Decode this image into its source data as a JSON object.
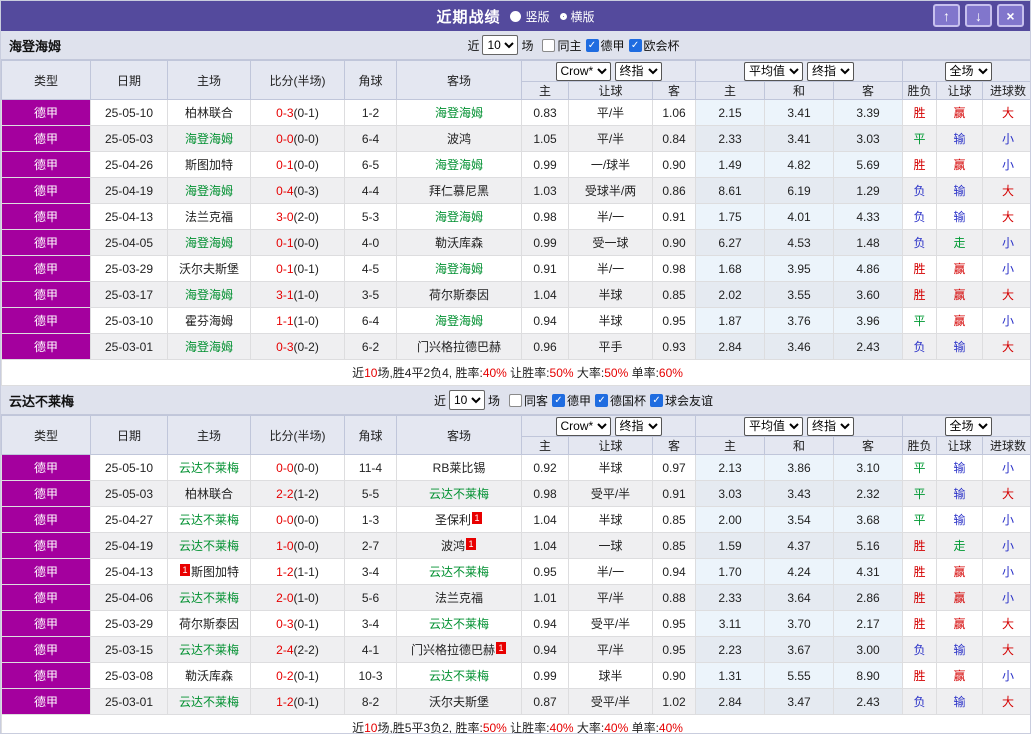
{
  "titlebar": {
    "title": "近期战绩",
    "radios": [
      {
        "label": "竖版",
        "selected": true
      },
      {
        "label": "横版",
        "selected": false
      }
    ],
    "buttons": {
      "up": "↑",
      "down": "↓",
      "close": "×"
    }
  },
  "colors": {
    "titlebar_bg": "#544a9d",
    "type_cell_bg": "#a4009e",
    "self_team": "#009030",
    "score_red": "#e60000",
    "win_red": "#d40000",
    "draw_green": "#009933",
    "loss_blue": "#2b32c8",
    "avg_col_bg": "#ecf4fb"
  },
  "outcome_colors": {
    "胜": "#d40000",
    "赢": "#d40000",
    "大": "#d40000",
    "平": "#009933",
    "走": "#009933",
    "负": "#2b32c8",
    "输": "#2b32c8",
    "小": "#2b32c8"
  },
  "table_headers": {
    "left": [
      "类型",
      "日期",
      "主场",
      "比分(半场)",
      "角球",
      "客场"
    ],
    "odds_selects": [
      "Crow*",
      "终指"
    ],
    "avg_selects": [
      "平均值",
      "终指"
    ],
    "full_select": "全场",
    "odds_cols": [
      "主",
      "让球",
      "客"
    ],
    "avg_cols": [
      "主",
      "和",
      "客"
    ],
    "result_cols": [
      "胜负",
      "让球",
      "进球数"
    ]
  },
  "filter_labels": {
    "prefix": "近",
    "suffix": "场"
  },
  "sections": [
    {
      "team": "海登海姆",
      "filter": {
        "count": "10",
        "checkboxes": [
          {
            "label": "同主",
            "checked": false
          },
          {
            "label": "德甲",
            "checked": true
          },
          {
            "label": "欧会杯",
            "checked": true
          }
        ]
      },
      "rows": [
        {
          "league": "德甲",
          "date": "25-05-10",
          "home": {
            "name": "柏林联合",
            "self": false
          },
          "score": "0-3",
          "half": "(0-1)",
          "corner": "1-2",
          "away": {
            "name": "海登海姆",
            "self": true
          },
          "odds": [
            "0.83",
            "平/半",
            "1.06"
          ],
          "avg": [
            "2.15",
            "3.41",
            "3.39"
          ],
          "results": [
            "胜",
            "赢",
            "大"
          ]
        },
        {
          "league": "德甲",
          "date": "25-05-03",
          "home": {
            "name": "海登海姆",
            "self": true
          },
          "score": "0-0",
          "half": "(0-0)",
          "corner": "6-4",
          "away": {
            "name": "波鸿",
            "self": false
          },
          "odds": [
            "1.05",
            "平/半",
            "0.84"
          ],
          "avg": [
            "2.33",
            "3.41",
            "3.03"
          ],
          "results": [
            "平",
            "输",
            "小"
          ]
        },
        {
          "league": "德甲",
          "date": "25-04-26",
          "home": {
            "name": "斯图加特",
            "self": false
          },
          "score": "0-1",
          "half": "(0-0)",
          "corner": "6-5",
          "away": {
            "name": "海登海姆",
            "self": true
          },
          "odds": [
            "0.99",
            "一/球半",
            "0.90"
          ],
          "avg": [
            "1.49",
            "4.82",
            "5.69"
          ],
          "results": [
            "胜",
            "赢",
            "小"
          ]
        },
        {
          "league": "德甲",
          "date": "25-04-19",
          "home": {
            "name": "海登海姆",
            "self": true
          },
          "score": "0-4",
          "half": "(0-3)",
          "corner": "4-4",
          "away": {
            "name": "拜仁慕尼黑",
            "self": false
          },
          "odds": [
            "1.03",
            "受球半/两",
            "0.86"
          ],
          "avg": [
            "8.61",
            "6.19",
            "1.29"
          ],
          "results": [
            "负",
            "输",
            "大"
          ]
        },
        {
          "league": "德甲",
          "date": "25-04-13",
          "home": {
            "name": "法兰克福",
            "self": false
          },
          "score": "3-0",
          "half": "(2-0)",
          "corner": "5-3",
          "away": {
            "name": "海登海姆",
            "self": true
          },
          "odds": [
            "0.98",
            "半/一",
            "0.91"
          ],
          "avg": [
            "1.75",
            "4.01",
            "4.33"
          ],
          "results": [
            "负",
            "输",
            "大"
          ]
        },
        {
          "league": "德甲",
          "date": "25-04-05",
          "home": {
            "name": "海登海姆",
            "self": true
          },
          "score": "0-1",
          "half": "(0-0)",
          "corner": "4-0",
          "away": {
            "name": "勒沃库森",
            "self": false
          },
          "odds": [
            "0.99",
            "受一球",
            "0.90"
          ],
          "avg": [
            "6.27",
            "4.53",
            "1.48"
          ],
          "results": [
            "负",
            "走",
            "小"
          ]
        },
        {
          "league": "德甲",
          "date": "25-03-29",
          "home": {
            "name": "沃尔夫斯堡",
            "self": false
          },
          "score": "0-1",
          "half": "(0-1)",
          "corner": "4-5",
          "away": {
            "name": "海登海姆",
            "self": true
          },
          "odds": [
            "0.91",
            "半/一",
            "0.98"
          ],
          "avg": [
            "1.68",
            "3.95",
            "4.86"
          ],
          "results": [
            "胜",
            "赢",
            "小"
          ]
        },
        {
          "league": "德甲",
          "date": "25-03-17",
          "home": {
            "name": "海登海姆",
            "self": true
          },
          "score": "3-1",
          "half": "(1-0)",
          "corner": "3-5",
          "away": {
            "name": "荷尔斯泰因",
            "self": false
          },
          "odds": [
            "1.04",
            "半球",
            "0.85"
          ],
          "avg": [
            "2.02",
            "3.55",
            "3.60"
          ],
          "results": [
            "胜",
            "赢",
            "大"
          ]
        },
        {
          "league": "德甲",
          "date": "25-03-10",
          "home": {
            "name": "霍芬海姆",
            "self": false
          },
          "score": "1-1",
          "half": "(1-0)",
          "corner": "6-4",
          "away": {
            "name": "海登海姆",
            "self": true
          },
          "odds": [
            "0.94",
            "半球",
            "0.95"
          ],
          "avg": [
            "1.87",
            "3.76",
            "3.96"
          ],
          "results": [
            "平",
            "赢",
            "小"
          ]
        },
        {
          "league": "德甲",
          "date": "25-03-01",
          "home": {
            "name": "海登海姆",
            "self": true
          },
          "score": "0-3",
          "half": "(0-2)",
          "corner": "6-2",
          "away": {
            "name": "门兴格拉德巴赫",
            "self": false
          },
          "odds": [
            "0.96",
            "平手",
            "0.93"
          ],
          "avg": [
            "2.84",
            "3.46",
            "2.43"
          ],
          "results": [
            "负",
            "输",
            "大"
          ]
        }
      ],
      "summary": [
        {
          "t": "近"
        },
        {
          "t": "10",
          "red": true
        },
        {
          "t": "场,胜4平2负4, 胜率:"
        },
        {
          "t": "40%",
          "red": true
        },
        {
          "t": " 让胜率:"
        },
        {
          "t": "50%",
          "red": true
        },
        {
          "t": " 大率:"
        },
        {
          "t": "50%",
          "red": true
        },
        {
          "t": " 单率:"
        },
        {
          "t": "60%",
          "red": true
        }
      ]
    },
    {
      "team": "云达不莱梅",
      "filter": {
        "count": "10",
        "checkboxes": [
          {
            "label": "同客",
            "checked": false
          },
          {
            "label": "德甲",
            "checked": true
          },
          {
            "label": "德国杯",
            "checked": true
          },
          {
            "label": "球会友谊",
            "checked": true
          }
        ]
      },
      "rows": [
        {
          "league": "德甲",
          "date": "25-05-10",
          "home": {
            "name": "云达不莱梅",
            "self": true
          },
          "score": "0-0",
          "half": "(0-0)",
          "corner": "11-4",
          "away": {
            "name": "RB莱比锡",
            "self": false
          },
          "odds": [
            "0.92",
            "半球",
            "0.97"
          ],
          "avg": [
            "2.13",
            "3.86",
            "3.10"
          ],
          "results": [
            "平",
            "输",
            "小"
          ]
        },
        {
          "league": "德甲",
          "date": "25-05-03",
          "home": {
            "name": "柏林联合",
            "self": false
          },
          "score": "2-2",
          "half": "(1-2)",
          "corner": "5-5",
          "away": {
            "name": "云达不莱梅",
            "self": true
          },
          "odds": [
            "0.98",
            "受平/半",
            "0.91"
          ],
          "avg": [
            "3.03",
            "3.43",
            "2.32"
          ],
          "results": [
            "平",
            "输",
            "大"
          ]
        },
        {
          "league": "德甲",
          "date": "25-04-27",
          "home": {
            "name": "云达不莱梅",
            "self": true
          },
          "score": "0-0",
          "half": "(0-0)",
          "corner": "1-3",
          "away": {
            "name": "圣保利",
            "self": false,
            "badge": "1",
            "badge_pos": "after"
          },
          "odds": [
            "1.04",
            "半球",
            "0.85"
          ],
          "avg": [
            "2.00",
            "3.54",
            "3.68"
          ],
          "results": [
            "平",
            "输",
            "小"
          ]
        },
        {
          "league": "德甲",
          "date": "25-04-19",
          "home": {
            "name": "云达不莱梅",
            "self": true
          },
          "score": "1-0",
          "half": "(0-0)",
          "corner": "2-7",
          "away": {
            "name": "波鸿",
            "self": false,
            "badge": "1",
            "badge_pos": "after"
          },
          "odds": [
            "1.04",
            "一球",
            "0.85"
          ],
          "avg": [
            "1.59",
            "4.37",
            "5.16"
          ],
          "results": [
            "胜",
            "走",
            "小"
          ]
        },
        {
          "league": "德甲",
          "date": "25-04-13",
          "home": {
            "name": "斯图加特",
            "self": false,
            "badge": "1",
            "badge_pos": "before"
          },
          "score": "1-2",
          "half": "(1-1)",
          "corner": "3-4",
          "away": {
            "name": "云达不莱梅",
            "self": true
          },
          "odds": [
            "0.95",
            "半/一",
            "0.94"
          ],
          "avg": [
            "1.70",
            "4.24",
            "4.31"
          ],
          "results": [
            "胜",
            "赢",
            "小"
          ]
        },
        {
          "league": "德甲",
          "date": "25-04-06",
          "home": {
            "name": "云达不莱梅",
            "self": true
          },
          "score": "2-0",
          "half": "(1-0)",
          "corner": "5-6",
          "away": {
            "name": "法兰克福",
            "self": false
          },
          "odds": [
            "1.01",
            "平/半",
            "0.88"
          ],
          "avg": [
            "2.33",
            "3.64",
            "2.86"
          ],
          "results": [
            "胜",
            "赢",
            "小"
          ]
        },
        {
          "league": "德甲",
          "date": "25-03-29",
          "home": {
            "name": "荷尔斯泰因",
            "self": false
          },
          "score": "0-3",
          "half": "(0-1)",
          "corner": "3-4",
          "away": {
            "name": "云达不莱梅",
            "self": true
          },
          "odds": [
            "0.94",
            "受平/半",
            "0.95"
          ],
          "avg": [
            "3.11",
            "3.70",
            "2.17"
          ],
          "results": [
            "胜",
            "赢",
            "大"
          ]
        },
        {
          "league": "德甲",
          "date": "25-03-15",
          "home": {
            "name": "云达不莱梅",
            "self": true
          },
          "score": "2-4",
          "half": "(2-2)",
          "corner": "4-1",
          "away": {
            "name": "门兴格拉德巴赫",
            "self": false,
            "badge": "1",
            "badge_pos": "after"
          },
          "odds": [
            "0.94",
            "平/半",
            "0.95"
          ],
          "avg": [
            "2.23",
            "3.67",
            "3.00"
          ],
          "results": [
            "负",
            "输",
            "大"
          ]
        },
        {
          "league": "德甲",
          "date": "25-03-08",
          "home": {
            "name": "勒沃库森",
            "self": false
          },
          "score": "0-2",
          "half": "(0-1)",
          "corner": "10-3",
          "away": {
            "name": "云达不莱梅",
            "self": true
          },
          "odds": [
            "0.99",
            "球半",
            "0.90"
          ],
          "avg": [
            "1.31",
            "5.55",
            "8.90"
          ],
          "results": [
            "胜",
            "赢",
            "小"
          ]
        },
        {
          "league": "德甲",
          "date": "25-03-01",
          "home": {
            "name": "云达不莱梅",
            "self": true
          },
          "score": "1-2",
          "half": "(0-1)",
          "corner": "8-2",
          "away": {
            "name": "沃尔夫斯堡",
            "self": false
          },
          "odds": [
            "0.87",
            "受平/半",
            "1.02"
          ],
          "avg": [
            "2.84",
            "3.47",
            "2.43"
          ],
          "results": [
            "负",
            "输",
            "大"
          ]
        }
      ],
      "summary": [
        {
          "t": "近"
        },
        {
          "t": "10",
          "red": true
        },
        {
          "t": "场,胜5平3负2, 胜率:"
        },
        {
          "t": "50%",
          "red": true
        },
        {
          "t": " 让胜率:"
        },
        {
          "t": "40%",
          "red": true
        },
        {
          "t": " 大率:"
        },
        {
          "t": "40%",
          "red": true
        },
        {
          "t": " 单率:"
        },
        {
          "t": "40%",
          "red": true
        }
      ]
    }
  ]
}
